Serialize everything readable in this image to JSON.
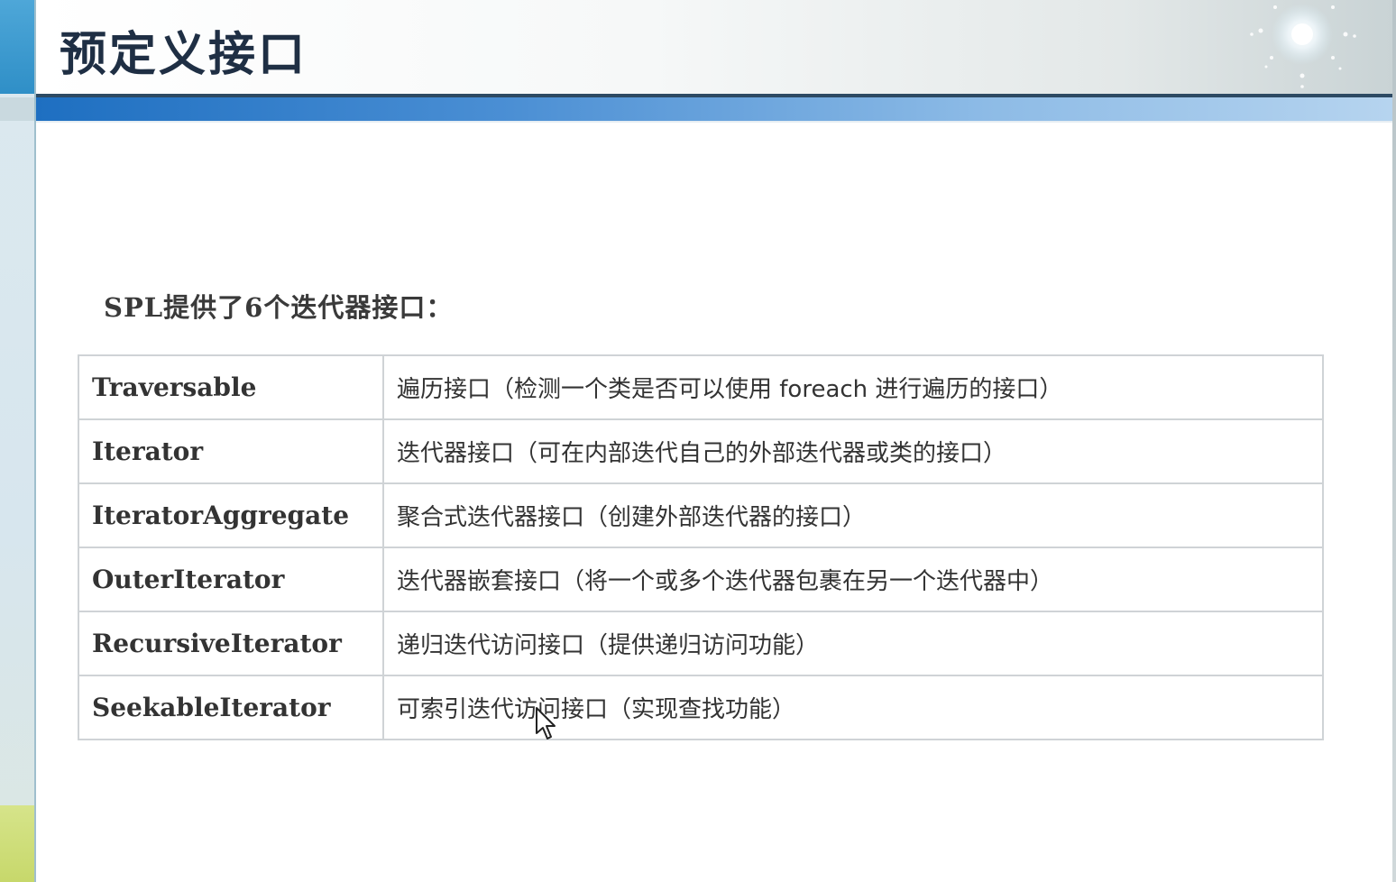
{
  "slide": {
    "title": "预定义接口",
    "intro": "SPL提供了6个迭代器接口："
  },
  "table": {
    "rows": [
      {
        "name": "Traversable",
        "desc": "遍历接口（检测一个类是否可以使用 foreach 进行遍历的接口）"
      },
      {
        "name": "Iterator",
        "desc": "迭代器接口（可在内部迭代自己的外部迭代器或类的接口）"
      },
      {
        "name": "IteratorAggregate",
        "desc": "聚合式迭代器接口（创建外部迭代器的接口）"
      },
      {
        "name": "OuterIterator",
        "desc": "迭代器嵌套接口（将一个或多个迭代器包裹在另一个迭代器中）"
      },
      {
        "name": "RecursiveIterator",
        "desc": "递归迭代访问接口（提供递归访问功能）"
      },
      {
        "name": "SeekableIterator",
        "desc": "可索引迭代访问接口（实现查找功能）"
      }
    ]
  },
  "theme": {
    "accent": "#1e6fc1",
    "title_color": "#1f2f44",
    "left_strip": "#2f8fc7",
    "footer_accent": "#c7d86b"
  },
  "icons": {
    "decoration": "sparkle-icon",
    "pointer": "mouse-cursor-icon"
  }
}
